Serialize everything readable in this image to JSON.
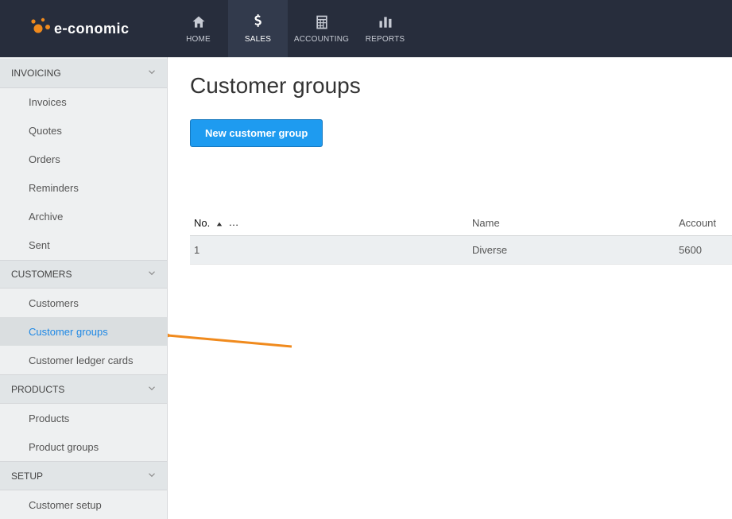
{
  "brand": {
    "name": "e-conomic"
  },
  "navbar": {
    "items": [
      {
        "key": "home",
        "label": "HOME"
      },
      {
        "key": "sales",
        "label": "SALES"
      },
      {
        "key": "accounting",
        "label": "ACCOUNTING"
      },
      {
        "key": "reports",
        "label": "REPORTS"
      }
    ],
    "active": "sales"
  },
  "sidebar": {
    "sections": [
      {
        "key": "invoicing",
        "label": "INVOICING",
        "items": [
          "Invoices",
          "Quotes",
          "Orders",
          "Reminders",
          "Archive",
          "Sent"
        ]
      },
      {
        "key": "customers",
        "label": "CUSTOMERS",
        "items": [
          "Customers",
          "Customer groups",
          "Customer ledger cards"
        ],
        "activeItem": "Customer groups"
      },
      {
        "key": "products",
        "label": "PRODUCTS",
        "items": [
          "Products",
          "Product groups"
        ]
      },
      {
        "key": "setup",
        "label": "SETUP",
        "items": [
          "Customer setup"
        ]
      }
    ]
  },
  "page": {
    "title": "Customer groups",
    "primary_button": "New customer group"
  },
  "table": {
    "columns": {
      "no": "No.",
      "name": "Name",
      "account": "Account"
    },
    "rows": [
      {
        "no": "1",
        "name": "Diverse",
        "account": "5600"
      }
    ]
  }
}
